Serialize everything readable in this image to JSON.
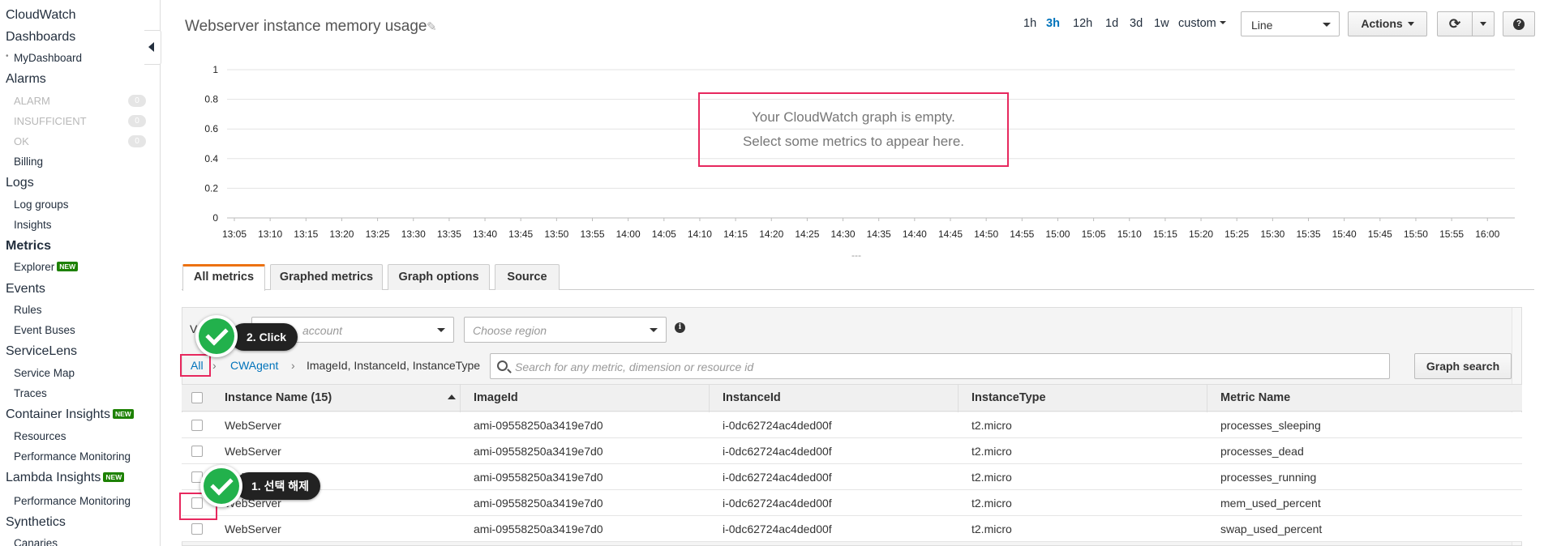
{
  "sidebar": {
    "cloudwatch": "CloudWatch",
    "dashboards": "Dashboards",
    "my_dashboard": "MyDashboard",
    "alarms": "Alarms",
    "alarm": "ALARM",
    "alarm_count": "0",
    "insufficient": "INSUFFICIENT",
    "insufficient_count": "0",
    "ok": "OK",
    "ok_count": "0",
    "billing": "Billing",
    "logs": "Logs",
    "log_groups": "Log groups",
    "insights": "Insights",
    "metrics": "Metrics",
    "explorer": "Explorer",
    "events": "Events",
    "rules": "Rules",
    "event_buses": "Event Buses",
    "servicelens": "ServiceLens",
    "service_map": "Service Map",
    "traces": "Traces",
    "container_insights": "Container Insights",
    "resources": "Resources",
    "performance_monitoring": "Performance Monitoring",
    "lambda_insights": "Lambda Insights",
    "lambda_performance_monitoring": "Performance Monitoring",
    "synthetics": "Synthetics",
    "canaries": "Canaries",
    "new_badge": "NEW"
  },
  "header": {
    "title": "Webserver instance memory usage",
    "ranges": [
      "1h",
      "3h",
      "12h",
      "1d",
      "3d",
      "1w"
    ],
    "active_range": "3h",
    "custom": "custom",
    "chart_type": "Line",
    "actions": "Actions",
    "help": "?"
  },
  "graph": {
    "empty_line1": "Your CloudWatch graph is empty.",
    "empty_line2": "Select some metrics to appear here.",
    "resize_handle": "---"
  },
  "chart_data": {
    "type": "line",
    "title": "Webserver instance memory usage",
    "xlabel": "",
    "ylabel": "",
    "x": [
      "13:05",
      "13:10",
      "13:15",
      "13:20",
      "13:25",
      "13:30",
      "13:35",
      "13:40",
      "13:45",
      "13:50",
      "13:55",
      "14:00",
      "14:05",
      "14:10",
      "14:15",
      "14:20",
      "14:25",
      "14:30",
      "14:35",
      "14:40",
      "14:45",
      "14:50",
      "14:55",
      "15:00",
      "15:05",
      "15:10",
      "15:15",
      "15:20",
      "15:25",
      "15:30",
      "15:35",
      "15:40",
      "15:45",
      "15:50",
      "15:55",
      "16:00"
    ],
    "yticks": [
      "1",
      "0.8",
      "0.6",
      "0.4",
      "0.2",
      "0"
    ],
    "ylim": [
      0,
      1
    ],
    "series": [],
    "grid": true,
    "colors": {
      "grid": "#e3e3e3",
      "axis": "#bbbbbb"
    }
  },
  "tabs": [
    "All metrics",
    "Graphed metrics",
    "Graph options",
    "Source"
  ],
  "filters": {
    "view_label": "V",
    "account_placeholder": "account",
    "region_placeholder": "Choose region"
  },
  "breadcrumb": {
    "all": "All",
    "namespace": "CWAgent",
    "dimensions": "ImageId, InstanceId, InstanceType"
  },
  "search": {
    "placeholder": "Search for any metric, dimension or resource id",
    "button": "Graph search"
  },
  "table": {
    "columns": [
      "Instance Name (15)",
      "ImageId",
      "InstanceId",
      "InstanceType",
      "Metric Name"
    ],
    "rows": [
      [
        "WebServer",
        "ami-09558250a3419e7d0",
        "i-0dc62724ac4ded00f",
        "t2.micro",
        "processes_sleeping"
      ],
      [
        "WebServer",
        "ami-09558250a3419e7d0",
        "i-0dc62724ac4ded00f",
        "t2.micro",
        "processes_dead"
      ],
      [
        "WebServer",
        "ami-09558250a3419e7d0",
        "i-0dc62724ac4ded00f",
        "t2.micro",
        "processes_running"
      ],
      [
        "WebServer",
        "ami-09558250a3419e7d0",
        "i-0dc62724ac4ded00f",
        "t2.micro",
        "mem_used_percent"
      ],
      [
        "WebServer",
        "ami-09558250a3419e7d0",
        "i-0dc62724ac4ded00f",
        "t2.micro",
        "swap_used_percent"
      ]
    ]
  },
  "annotations": {
    "step2": "2. Click",
    "step1": "1. 선택 해제",
    "highlight_color": "#e7285e",
    "check_color": "#22b14c"
  }
}
